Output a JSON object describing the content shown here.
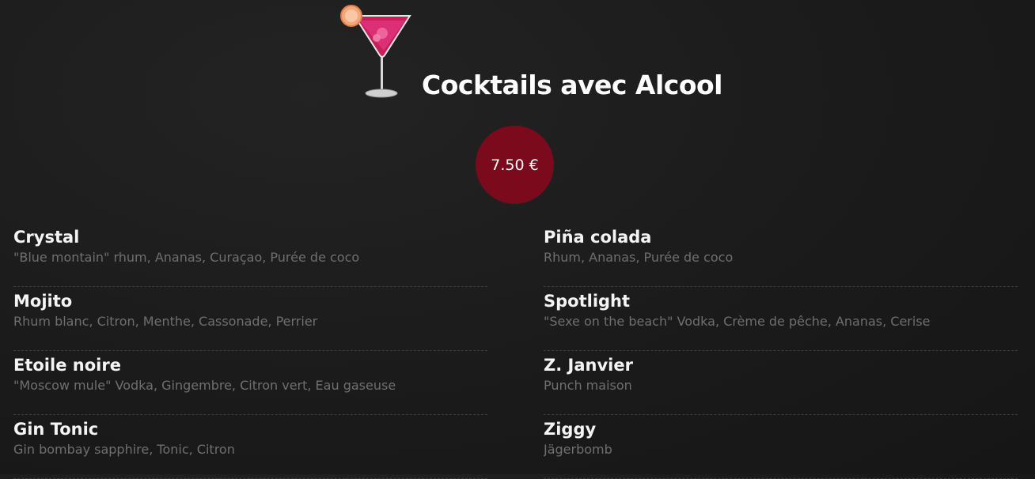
{
  "header": {
    "title": "Cocktails avec Alcool",
    "icon": "cocktail-glass-icon"
  },
  "price": "7.50 €",
  "colors": {
    "accent": "#7b0a1c",
    "background": "#1c1c1c",
    "text": "#f2f2f2",
    "muted": "#6f6f6f"
  },
  "menu": {
    "left": [
      {
        "name": "Crystal",
        "desc": "\"Blue montain\" rhum, Ananas, Curaçao, Purée de coco"
      },
      {
        "name": "Mojito",
        "desc": "Rhum blanc, Citron, Menthe, Cassonade, Perrier"
      },
      {
        "name": "Etoile noire",
        "desc": "\"Moscow mule\" Vodka, Gingembre, Citron vert, Eau gaseuse"
      },
      {
        "name": "Gin Tonic",
        "desc": "Gin bombay sapphire, Tonic, Citron"
      }
    ],
    "right": [
      {
        "name": "Piña colada",
        "desc": "Rhum, Ananas, Purée de coco"
      },
      {
        "name": "Spotlight",
        "desc": "\"Sexe on the beach\" Vodka, Crème de pêche, Ananas, Cerise"
      },
      {
        "name": "Z. Janvier",
        "desc": "Punch maison"
      },
      {
        "name": "Ziggy",
        "desc": "Jägerbomb"
      }
    ]
  }
}
